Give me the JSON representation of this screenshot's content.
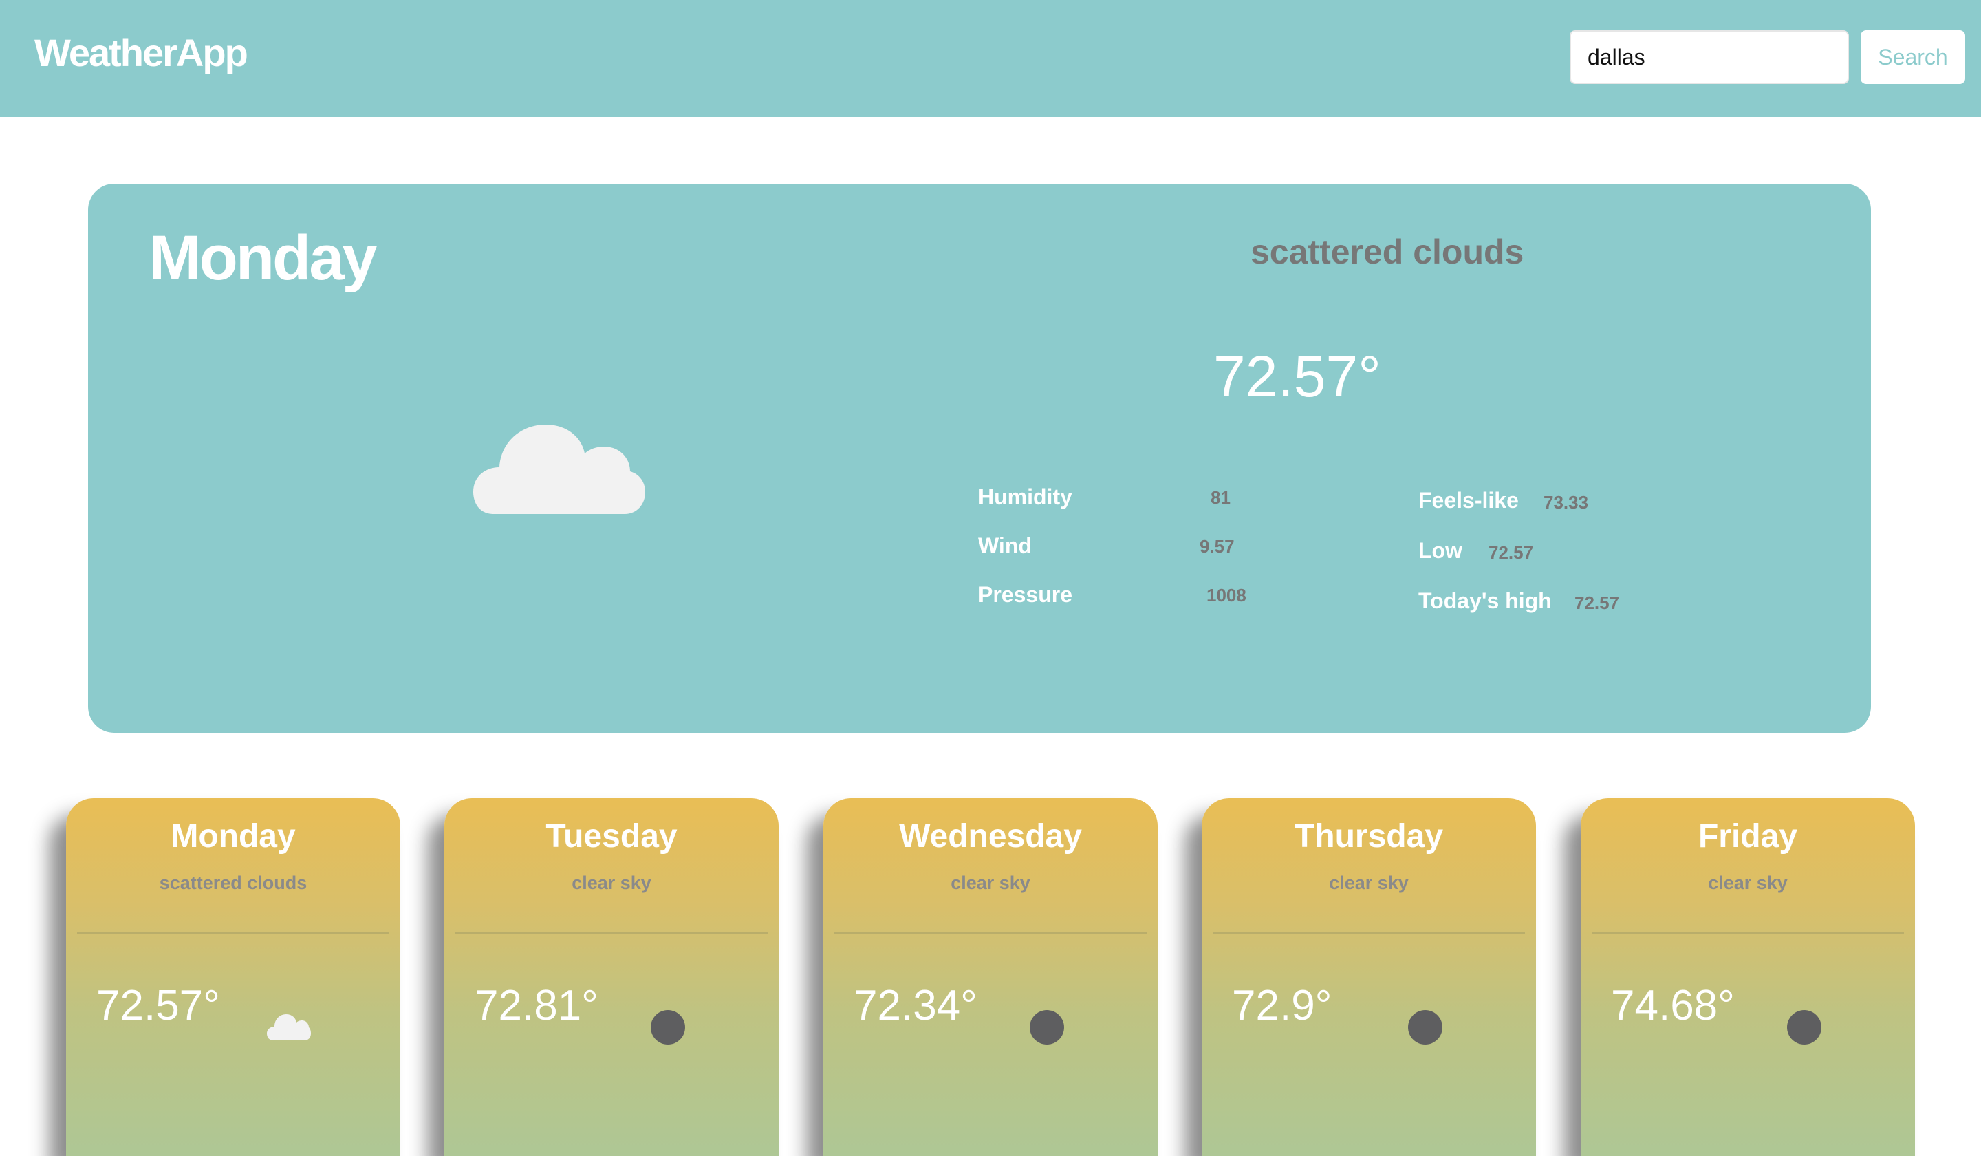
{
  "header": {
    "brand": "WeatherApp",
    "search_value": "dallas",
    "search_button": "Search"
  },
  "current": {
    "day": "Monday",
    "description": "scattered clouds",
    "temperature": "72.57°",
    "icon": "cloud-icon",
    "stats_left": [
      {
        "label": "Humidity",
        "value": "81"
      },
      {
        "label": "Wind",
        "value": "9.57"
      },
      {
        "label": "Pressure",
        "value": "1008"
      }
    ],
    "stats_right": [
      {
        "label": "Feels-like",
        "value": "73.33"
      },
      {
        "label": "Low",
        "value": "72.57"
      },
      {
        "label": "Today's high",
        "value": "72.57"
      }
    ]
  },
  "forecast": [
    {
      "day": "Monday",
      "description": "scattered clouds",
      "temperature": "72.57°",
      "icon": "cloud-icon"
    },
    {
      "day": "Tuesday",
      "description": "clear sky",
      "temperature": "72.81°",
      "icon": "sun-dot-icon"
    },
    {
      "day": "Wednesday",
      "description": "clear sky",
      "temperature": "72.34°",
      "icon": "sun-dot-icon"
    },
    {
      "day": "Thursday",
      "description": "clear sky",
      "temperature": "72.9°",
      "icon": "sun-dot-icon"
    },
    {
      "day": "Friday",
      "description": "clear sky",
      "temperature": "74.68°",
      "icon": "sun-dot-icon"
    }
  ],
  "colors": {
    "primary": "#8ccbcc",
    "card_top": "#e9be55",
    "card_bottom": "#aec795",
    "muted_text": "#777777",
    "icon_dot": "#5e5e60"
  }
}
